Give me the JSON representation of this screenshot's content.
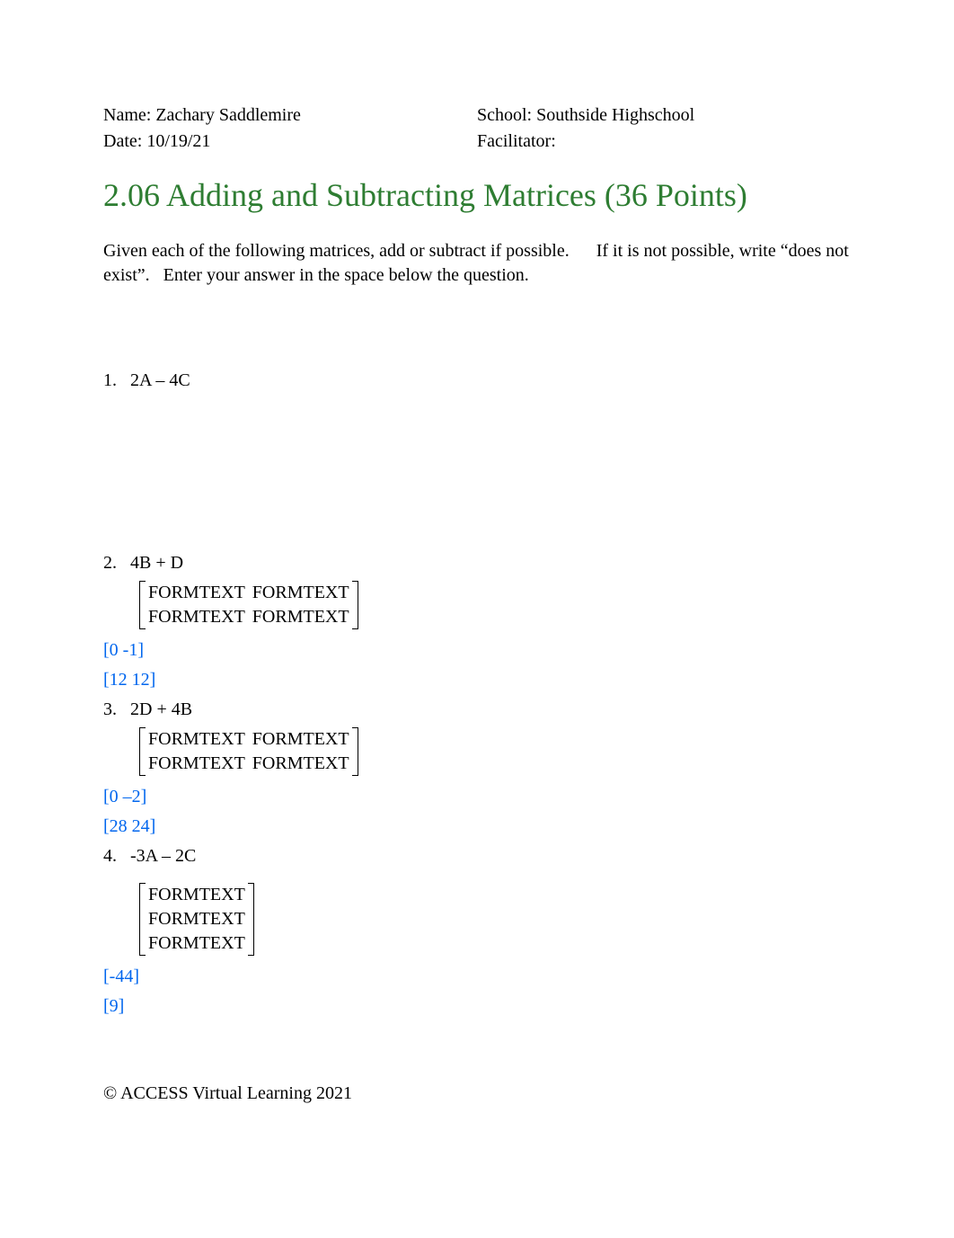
{
  "header": {
    "name_label": "Name: ",
    "name_value": "Zachary Saddlemire",
    "date_label": "Date: ",
    "date_value": "10/19/21",
    "school_label": "School: ",
    "school_value": "Southside Highschool",
    "facilitator_label": "Facilitator:",
    "facilitator_value": ""
  },
  "title": "2.06 Adding and Subtracting Matrices (36 Points)",
  "instructions": "Given each of the following matrices, add or subtract if possible.      If it is not possible, write “does not exist”.   Enter your answer in the space below the question.",
  "q1": {
    "num": "1.",
    "expr": "2A – 4C"
  },
  "q2": {
    "num": "2.",
    "expr": "4B + D",
    "m": {
      "r1c1": "FORMTEXT",
      "r1c2": "FORMTEXT",
      "r2c1": "FORMTEXT",
      "r2c2": "FORMTEXT"
    },
    "ans1": "[0  -1]",
    "ans2": "[12 12]"
  },
  "q3": {
    "num": "3.",
    "expr": "2D + 4B",
    "m": {
      "r1c1": "FORMTEXT",
      "r1c2": "FORMTEXT",
      "r2c1": "FORMTEXT",
      "r2c2": "FORMTEXT"
    },
    "ans1": "[0 –2]",
    "ans2": "[28 24]"
  },
  "q4": {
    "num": "4.",
    "expr": "-3A – 2C",
    "m": {
      "r1": "FORMTEXT",
      "r2": "FORMTEXT",
      "r3": "FORMTEXT"
    },
    "ans1": "[-44]",
    "ans2": "[9]"
  },
  "footer": "© ACCESS Virtual Learning 2021"
}
